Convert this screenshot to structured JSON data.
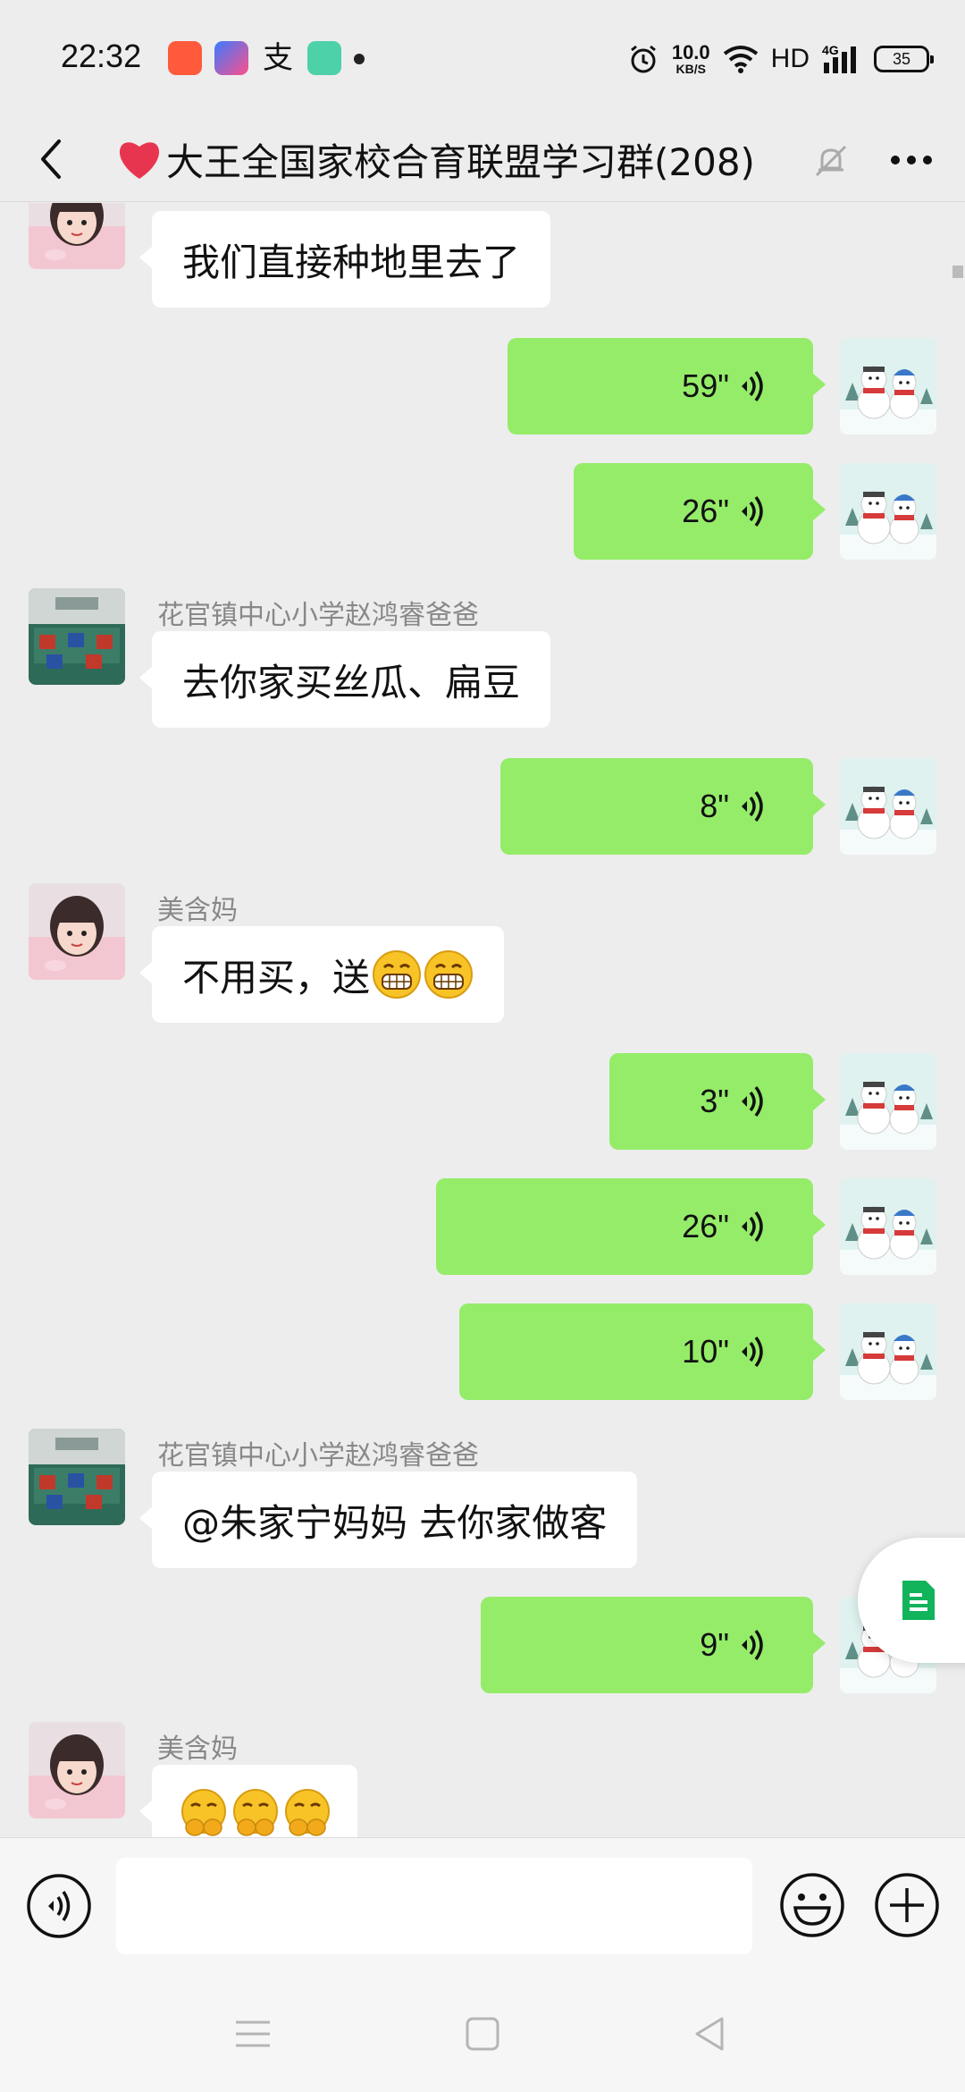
{
  "status_bar": {
    "time": "22:32",
    "net_speed_value": "10.0",
    "net_speed_unit": "KB/S",
    "hd_label": "HD",
    "network_label": "4G",
    "battery": "35"
  },
  "header": {
    "title": "大王全国家校合育联盟学习群(208)"
  },
  "messages": {
    "m1": {
      "text": "我们直接种地里去了"
    },
    "v1": {
      "duration": "59\""
    },
    "v2": {
      "duration": "26\""
    },
    "m2": {
      "sender": "花官镇中心小学赵鸿睿爸爸",
      "text": "去你家买丝瓜、扁豆"
    },
    "v3": {
      "duration": "8\""
    },
    "m3": {
      "sender": "美含妈",
      "text": "不用买，送"
    },
    "v4": {
      "duration": "3\""
    },
    "v5": {
      "duration": "26\""
    },
    "v6": {
      "duration": "10\""
    },
    "m4": {
      "sender": "花官镇中心小学赵鸿睿爸爸",
      "text": "@朱家宁妈妈  去你家做客"
    },
    "v7": {
      "duration": "9\""
    },
    "m5": {
      "sender": "美含妈"
    }
  },
  "input": {
    "value": "",
    "placeholder": ""
  },
  "colors": {
    "background": "#ededed",
    "my_bubble": "#95ec69",
    "their_bubble": "#ffffff",
    "sender_name": "#888888",
    "heart": "#e8354f"
  }
}
